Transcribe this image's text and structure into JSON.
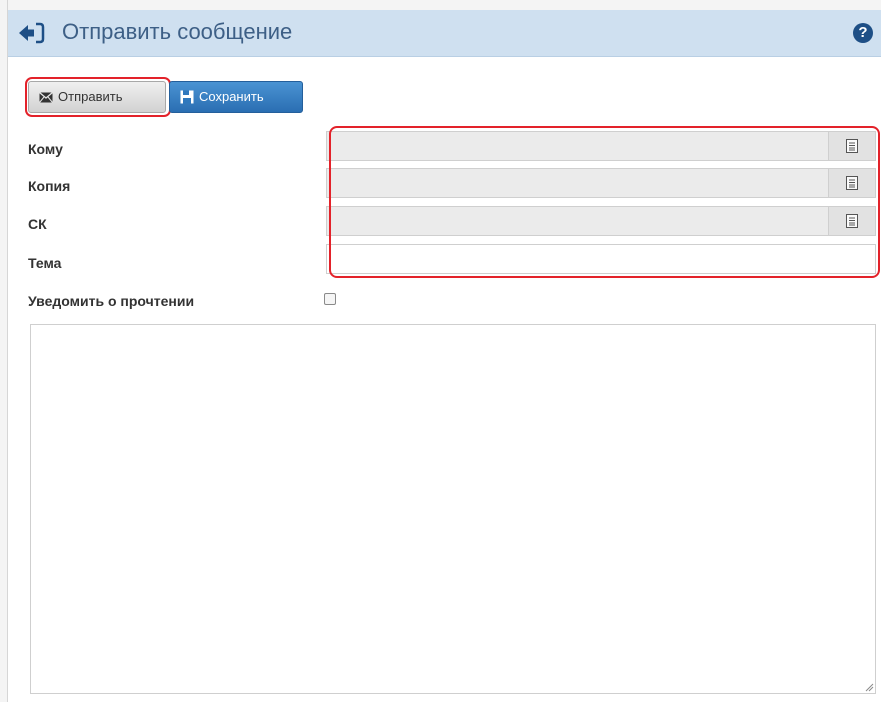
{
  "header": {
    "title": "Отправить сообщение",
    "help_glyph": "?",
    "back_icon": "sign-in-arrow-icon",
    "help_icon": "question-circle-icon",
    "background": "#cfe0f0",
    "title_color": "#3d5f86"
  },
  "toolbar": {
    "send_label": "Отправить",
    "save_label": "Сохранить",
    "send_icon": "envelope-icon",
    "save_icon": "floppy-disk-icon",
    "save_color": "#2f78bd"
  },
  "form": {
    "to_label": "Кому",
    "to_value": "",
    "cc_label": "Копия",
    "cc_value": "",
    "bcc_label": "СК",
    "bcc_value": "",
    "subject_label": "Тема",
    "subject_value": "",
    "read_receipt_label": "Уведомить о прочтении",
    "read_receipt_checked": false,
    "address_book_icon": "address-book-icon",
    "message_body": ""
  },
  "highlight_color": "#e3222a"
}
